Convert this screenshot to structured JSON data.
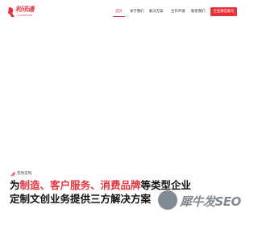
{
  "brand": {
    "logo_text": "利讯通",
    "logo_subtext": "LIXUNTONG",
    "accent_color": "#e5333d"
  },
  "nav": {
    "items": [
      {
        "label": "首页",
        "active": true
      },
      {
        "label": "关于我们",
        "active": false
      },
      {
        "label": "解决方案",
        "active": false
      },
      {
        "label": "合作申请",
        "active": false
      },
      {
        "label": "联系我们",
        "active": false
      }
    ]
  },
  "cta": {
    "label": "企业微信账号"
  },
  "hero": {
    "tag_label": "营销定制",
    "headline": {
      "line1_prefix": "为",
      "line1_highlight": "制造、客户服务、消费品牌",
      "line1_suffix": "等类型企业",
      "line2": "定制文创业务提供三方解决方案"
    }
  },
  "watermark": {
    "text": "犀牛发SEO"
  }
}
